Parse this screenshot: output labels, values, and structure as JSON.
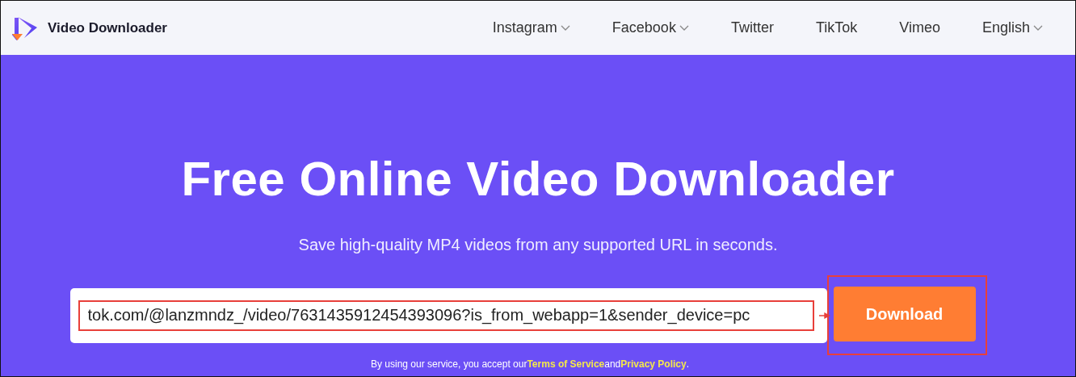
{
  "header": {
    "brand": "Video Downloader",
    "nav": [
      {
        "label": "Instagram",
        "dropdown": true
      },
      {
        "label": "Facebook",
        "dropdown": true
      },
      {
        "label": "Twitter",
        "dropdown": false
      },
      {
        "label": "TikTok",
        "dropdown": false
      },
      {
        "label": "Vimeo",
        "dropdown": false
      },
      {
        "label": "English",
        "dropdown": true
      }
    ]
  },
  "hero": {
    "title": "Free Online Video Downloader",
    "subtitle": "Save high-quality MP4 videos from any supported URL in seconds.",
    "url_field": {
      "value": "tok.com/@lanzmndz_/video/7631435912454393096?is_from_webapp=1&sender_device=pc",
      "highlighted": true
    },
    "download_button": {
      "label": "Download",
      "highlighted": true
    },
    "terms": [
      "By using our service, you accept our",
      "Terms of Service",
      "and",
      "Privacy Policy",
      "."
    ]
  }
}
